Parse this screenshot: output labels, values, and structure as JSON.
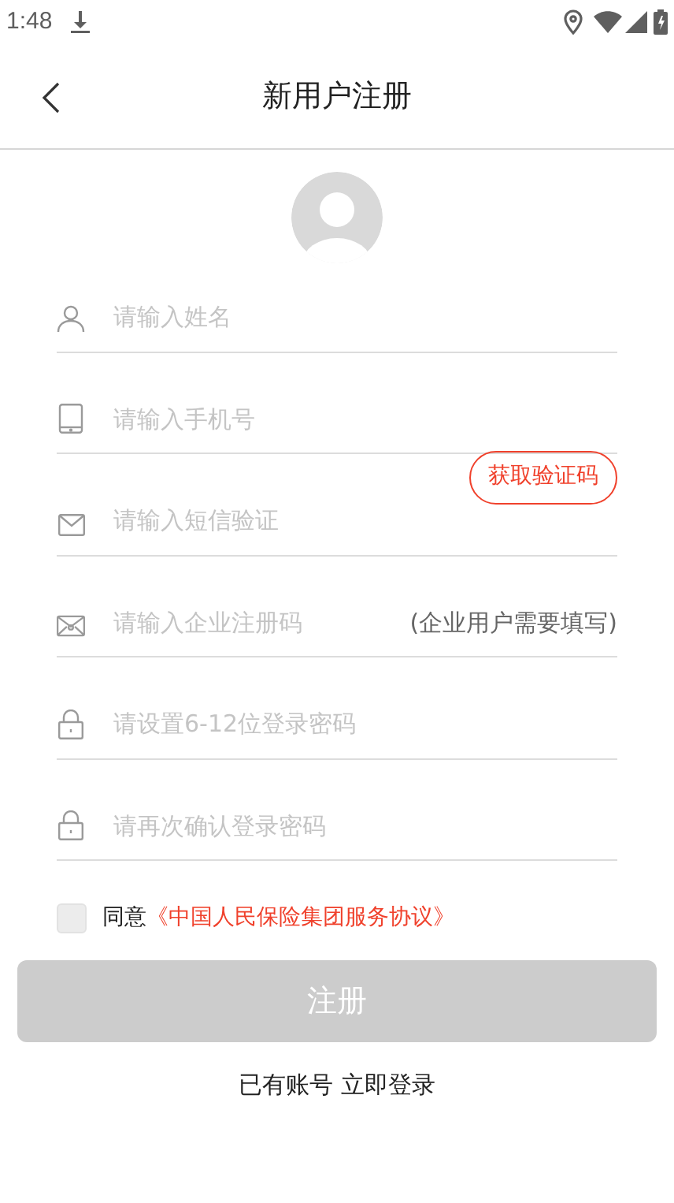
{
  "status_bar": {
    "time": "1:48"
  },
  "header": {
    "title": "新用户注册"
  },
  "fields": [
    {
      "kind": "person",
      "placeholder": "请输入姓名"
    },
    {
      "kind": "phone",
      "placeholder": "请输入手机号"
    },
    {
      "kind": "mail",
      "placeholder": "请输入短信验证",
      "action": "获取验证码"
    },
    {
      "kind": "envelope",
      "placeholder": "请输入企业注册码",
      "note": "(企业用户需要填写)"
    },
    {
      "kind": "lock",
      "placeholder": "请设置6-12位登录密码"
    },
    {
      "kind": "lock",
      "placeholder": "请再次确认登录密码"
    }
  ],
  "agreement": {
    "checked": false,
    "text": "同意",
    "link": "《中国人民保险集团服务协议》"
  },
  "submit": {
    "label": "注册",
    "disabled": true
  },
  "login_link": "已有账号 立即登录"
}
